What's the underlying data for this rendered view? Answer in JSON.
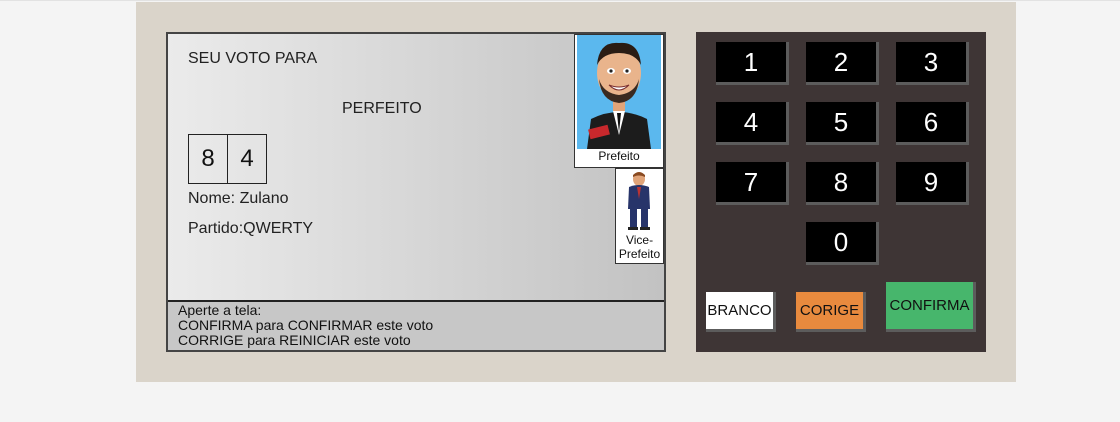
{
  "screen": {
    "title": "SEU VOTO PARA",
    "office": "PERFEITO",
    "digits": [
      "8",
      "4"
    ],
    "name_line": "Nome: Zulano",
    "party_line": "Partido:QWERTY",
    "candidate_caption": "Prefeito",
    "vice_caption_1": "Vice-",
    "vice_caption_2": "Prefeito",
    "instructions": [
      "Aperte a tela:",
      "CONFIRMA para CONFIRMAR este voto",
      "CORRIGE para REINICIAR este voto"
    ]
  },
  "keypad": {
    "keys": [
      "1",
      "2",
      "3",
      "4",
      "5",
      "6",
      "7",
      "8",
      "9",
      "0"
    ],
    "branco_label": "BRANCO",
    "corrige_label": "CORIGE",
    "confirma_label": "CONFIRMA"
  },
  "colors": {
    "machine_bg": "#dad4ca",
    "keypad_bg": "#3e3535",
    "branco": "#ffffff",
    "corrige": "#e88a3e",
    "confirma": "#47b66c"
  }
}
